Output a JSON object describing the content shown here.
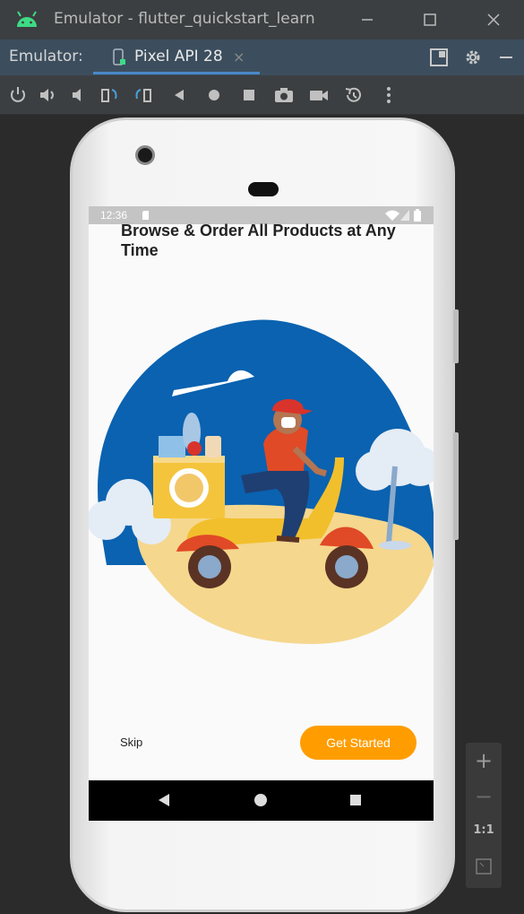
{
  "window": {
    "title": "Emulator - flutter_quickstart_learn",
    "controls": [
      "minimize",
      "maximize",
      "close"
    ]
  },
  "tabbar": {
    "label": "Emulator:",
    "tab": {
      "label": "Pixel API 28",
      "close": "×"
    }
  },
  "toolbar": {
    "icons": [
      "power-icon",
      "volume-up-icon",
      "volume-down-icon",
      "rotate-left-icon",
      "rotate-right-icon",
      "back-icon",
      "home-icon",
      "overview-icon",
      "screenshot-icon",
      "screenrecord-icon",
      "snapshot-icon",
      "more-icon"
    ]
  },
  "device": {
    "status": {
      "time": "12:36"
    },
    "screen": {
      "headline": "Browse & Order All Products at Any Time",
      "skip": "Skip",
      "cta": "Get Started"
    }
  },
  "zoom": {
    "in": "+",
    "out": "−",
    "ratio": "1:1"
  },
  "colors": {
    "accent": "#ff9d00",
    "tab_underline": "#4a88c7",
    "illustration_blue": "#0a62b0"
  }
}
